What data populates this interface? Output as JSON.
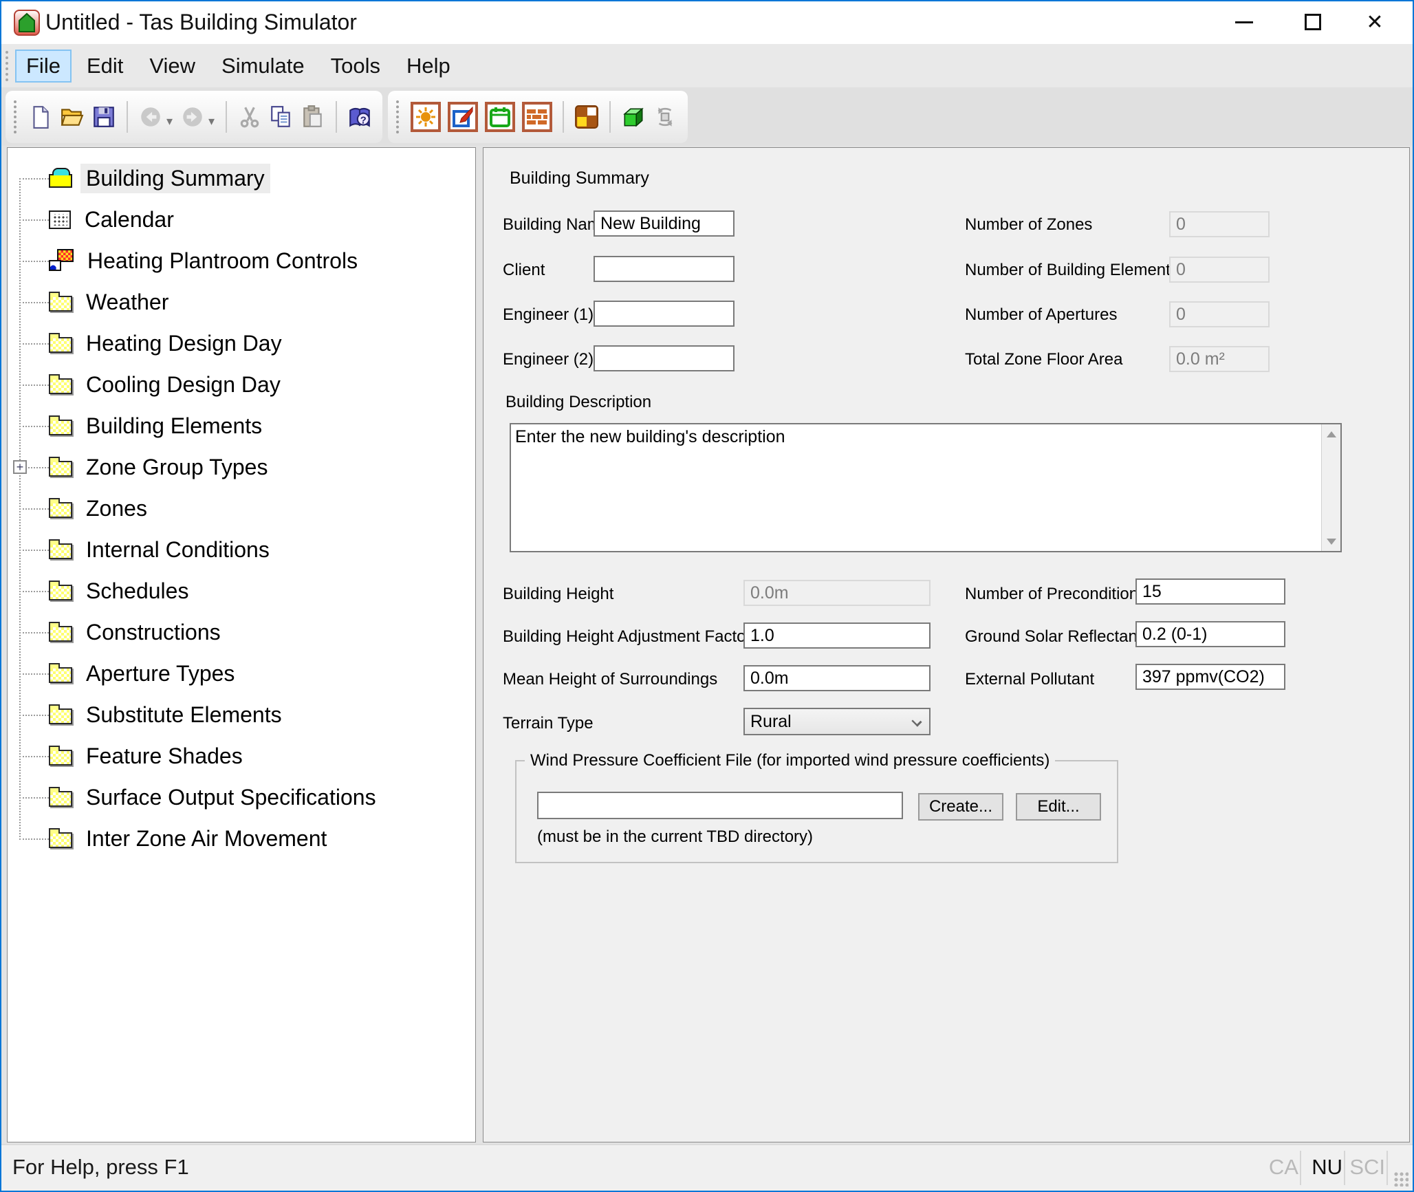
{
  "window": {
    "title": "Untitled - Tas Building Simulator",
    "app_icon": "tas-house-icon"
  },
  "menu": {
    "active_index": 0,
    "items": [
      {
        "label": "File"
      },
      {
        "label": "Edit"
      },
      {
        "label": "View"
      },
      {
        "label": "Simulate"
      },
      {
        "label": "Tools"
      },
      {
        "label": "Help"
      }
    ]
  },
  "toolbar": {
    "group1": [
      "new-file-icon",
      "open-file-icon",
      "save-icon",
      "back-icon",
      "forward-icon",
      "cut-icon",
      "copy-icon",
      "paste-icon",
      "help-book-icon"
    ],
    "group2": [
      "weather-sun-icon",
      "internal-conditions-icon",
      "schedules-calendar-icon",
      "constructions-bricks-icon",
      "zones-icon",
      "view-3d-cube-icon",
      "rotate-3d-icon"
    ]
  },
  "tree": {
    "items": [
      {
        "label": "Building Summary",
        "icon": "building-summary-icon",
        "selected": true
      },
      {
        "label": "Calendar",
        "icon": "calendar-icon"
      },
      {
        "label": "Heating Plantroom Controls",
        "icon": "plantroom-controls-icon"
      },
      {
        "label": "Weather",
        "icon": "folder-icon"
      },
      {
        "label": "Heating Design Day",
        "icon": "folder-icon"
      },
      {
        "label": "Cooling Design Day",
        "icon": "folder-icon"
      },
      {
        "label": "Building Elements",
        "icon": "folder-icon"
      },
      {
        "label": "Zone Group Types",
        "icon": "folder-icon",
        "expandable": true
      },
      {
        "label": "Zones",
        "icon": "folder-icon"
      },
      {
        "label": "Internal Conditions",
        "icon": "folder-icon"
      },
      {
        "label": "Schedules",
        "icon": "folder-icon"
      },
      {
        "label": "Constructions",
        "icon": "folder-icon"
      },
      {
        "label": "Aperture Types",
        "icon": "folder-icon"
      },
      {
        "label": "Substitute Elements",
        "icon": "folder-icon"
      },
      {
        "label": "Feature Shades",
        "icon": "folder-icon"
      },
      {
        "label": "Surface Output Specifications",
        "icon": "folder-icon"
      },
      {
        "label": "Inter Zone Air Movement",
        "icon": "folder-icon"
      }
    ]
  },
  "panel": {
    "caption": "Building Summary",
    "building_name": {
      "label": "Building Name",
      "value": "New Building"
    },
    "client": {
      "label": "Client",
      "value": ""
    },
    "engineer1": {
      "label": "Engineer (1)",
      "value": ""
    },
    "engineer2": {
      "label": "Engineer (2)",
      "value": ""
    },
    "num_zones": {
      "label": "Number of Zones",
      "value": "0"
    },
    "num_building_elements": {
      "label": "Number of Building Elements",
      "value": "0"
    },
    "num_apertures": {
      "label": "Number of Apertures",
      "value": "0"
    },
    "total_floor_area": {
      "label": "Total Zone Floor Area",
      "value": "0.0 m²"
    },
    "description": {
      "label": "Building Description",
      "value": "Enter the new building's description"
    },
    "building_height": {
      "label": "Building Height",
      "value": "0.0m"
    },
    "height_adjustment": {
      "label": "Building Height Adjustment Factor",
      "value": "1.0"
    },
    "mean_height": {
      "label": "Mean Height of Surroundings",
      "value": "0.0m"
    },
    "terrain": {
      "label": "Terrain Type",
      "value": "Rural"
    },
    "preconditioning_days": {
      "label": "Number of Preconditioning Days",
      "value": "15"
    },
    "ground_solar_reflectance": {
      "label": "Ground Solar Reflectance",
      "value": "0.2 (0-1)"
    },
    "external_pollutant": {
      "label": "External Pollutant",
      "value": "397 ppmv(CO2)"
    },
    "wind_group": {
      "legend": "Wind Pressure Coefficient File (for imported wind pressure coefficients)",
      "file_value": "",
      "create_label": "Create...",
      "edit_label": "Edit...",
      "note": "(must be in the current TBD directory)"
    }
  },
  "statusbar": {
    "help_text": "For Help, press F1",
    "indicators": [
      {
        "label": "CA",
        "on": false
      },
      {
        "label": "NU",
        "on": true
      },
      {
        "label": "SCI",
        "on": false
      }
    ]
  },
  "colors": {
    "accent": "#0076d7",
    "menu_highlight": "#cce8ff",
    "folder_yellow": "#ffff88"
  }
}
